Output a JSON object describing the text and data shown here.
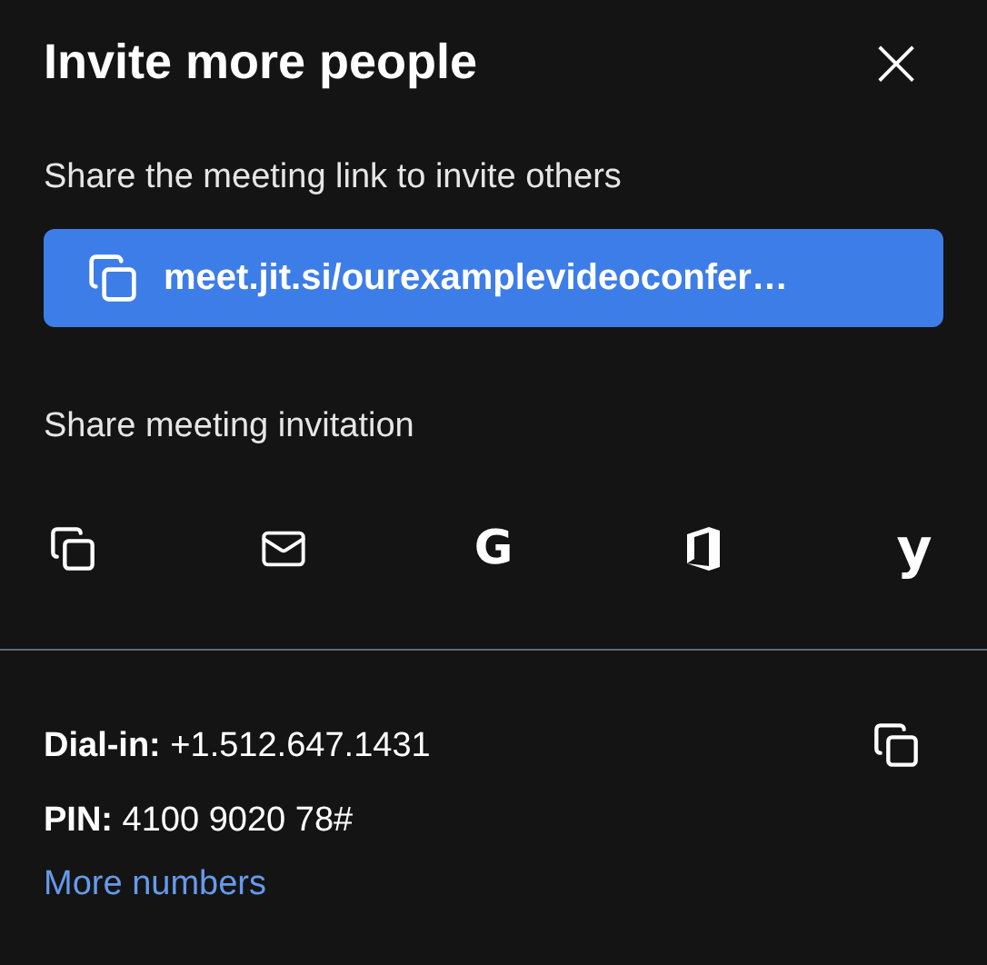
{
  "dialog": {
    "title": "Invite more people",
    "close_glyph": "×"
  },
  "link_section": {
    "label": "Share the meeting link to invite others",
    "link": "meet.jit.si/ourexamplevideoconfer…"
  },
  "share_section": {
    "label": "Share meeting invitation",
    "options": [
      {
        "kind": "copy"
      },
      {
        "kind": "email"
      },
      {
        "kind": "google",
        "glyph": "G"
      },
      {
        "kind": "office"
      },
      {
        "kind": "yahoo",
        "glyph": "y"
      }
    ]
  },
  "dial_in": {
    "number": "**Dial-in:** +1.512.647.1431",
    "pin": "**PIN:** 4100 9020 78#",
    "more": "More numbers"
  }
}
